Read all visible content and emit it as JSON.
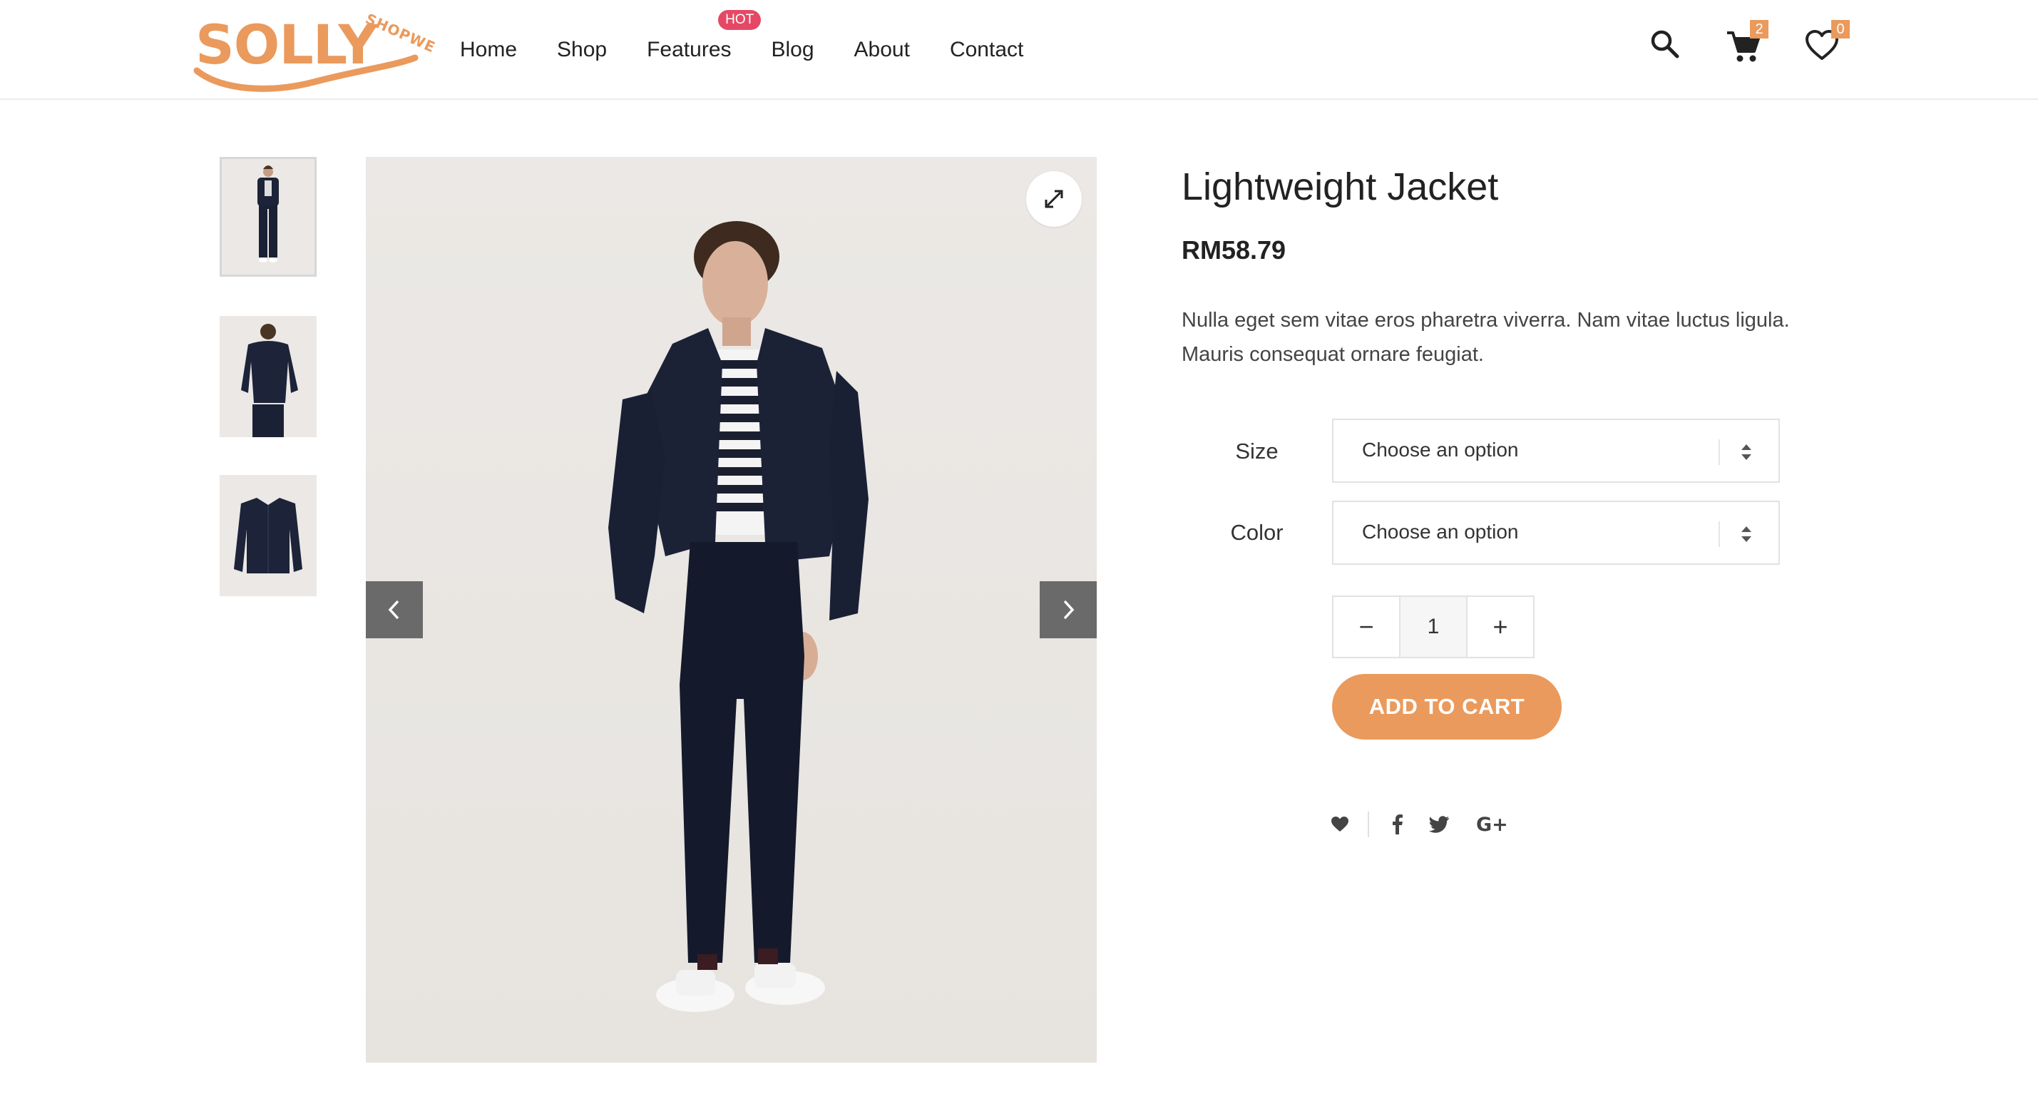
{
  "brand": {
    "logo_text": "SOLLY",
    "logo_sub": "SHOPWE",
    "accent_color": "#ea9a5c"
  },
  "nav": {
    "items": [
      {
        "label": "Home"
      },
      {
        "label": "Shop"
      },
      {
        "label": "Features",
        "badge": "HOT"
      },
      {
        "label": "Blog"
      },
      {
        "label": "About"
      },
      {
        "label": "Contact"
      }
    ]
  },
  "header_actions": {
    "search_icon": "search-icon",
    "cart_icon": "cart-icon",
    "cart_count": "2",
    "wishlist_icon": "heart-icon",
    "wishlist_count": "0"
  },
  "gallery": {
    "thumbnails": [
      "thumbnail-front",
      "thumbnail-back",
      "thumbnail-jacket"
    ],
    "active_thumbnail": 0,
    "zoom_icon": "expand-icon",
    "prev_icon": "chevron-left-icon",
    "next_icon": "chevron-right-icon"
  },
  "product": {
    "title": "Lightweight Jacket",
    "price": "RM58.79",
    "description": "Nulla eget sem vitae eros pharetra viverra. Nam vitae luctus ligula. Mauris consequat ornare feugiat.",
    "variations": [
      {
        "label": "Size",
        "value": "Choose an option"
      },
      {
        "label": "Color",
        "value": "Choose an option"
      }
    ],
    "quantity": "1",
    "minus_label": "−",
    "plus_label": "+",
    "add_to_cart_label": "ADD TO CART"
  },
  "share": {
    "icons": [
      "heart-icon",
      "facebook-icon",
      "twitter-icon",
      "google-plus-icon"
    ],
    "google_plus_label": "G+"
  }
}
